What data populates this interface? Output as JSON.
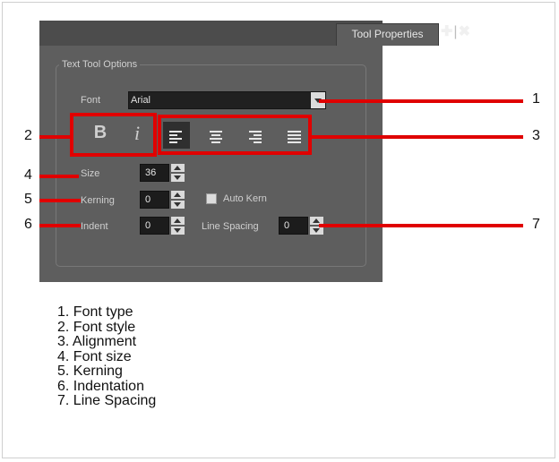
{
  "panel": {
    "tab_title": "Tool Properties",
    "add_glyph": "✚",
    "separator_glyph": "|",
    "close_glyph": "✖",
    "group_label": "Text Tool Options"
  },
  "font": {
    "label": "Font",
    "value": "Arial"
  },
  "style": {
    "bold_glyph": "B",
    "italic_glyph": "i"
  },
  "alignment": [
    "align-left",
    "align-center",
    "align-right",
    "justify"
  ],
  "size": {
    "label": "Size",
    "value": "36"
  },
  "kerning": {
    "label": "Kerning",
    "value": "0"
  },
  "auto_kern": {
    "label": "Auto Kern",
    "checked": false
  },
  "indent": {
    "label": "Indent",
    "value": "0"
  },
  "line_spacing": {
    "label": "Line Spacing",
    "value": "0"
  },
  "callouts": {
    "c1": "1",
    "c2": "2",
    "c3": "3",
    "c4": "4",
    "c5": "5",
    "c6": "6",
    "c7": "7"
  },
  "legend": [
    "1.  Font type",
    "2.  Font style",
    "3.  Alignment",
    "4.  Font size",
    "5.  Kerning",
    "6.  Indentation",
    "7.  Line Spacing"
  ],
  "colors": {
    "panel": "#5e5e5e",
    "field": "#1c1c1c",
    "callout": "#e00000"
  }
}
